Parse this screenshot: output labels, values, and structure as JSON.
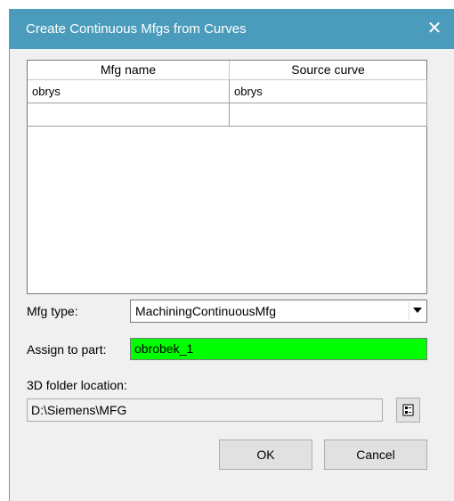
{
  "window": {
    "title": "Create Continuous Mfgs from Curves",
    "close_glyph": "✕"
  },
  "grid": {
    "columns": [
      "Mfg name",
      "Source curve"
    ],
    "rows": [
      [
        "obrys",
        "obrys"
      ],
      [
        "",
        ""
      ]
    ]
  },
  "form": {
    "mfg_type_label": "Mfg type:",
    "mfg_type_value": "MachiningContinuousMfg",
    "assign_label": "Assign to part:",
    "assign_value": "obrobek_1",
    "folder_label": "3D folder location:",
    "folder_value": "D:\\Siemens\\MFG"
  },
  "buttons": {
    "ok": "OK",
    "cancel": "Cancel"
  },
  "colors": {
    "titlebar": "#4b9cbc",
    "assign_field_bg": "#00ff00"
  },
  "icons": {
    "browse": "folder-browse-icon",
    "dropdown": "chevron-down-icon"
  }
}
